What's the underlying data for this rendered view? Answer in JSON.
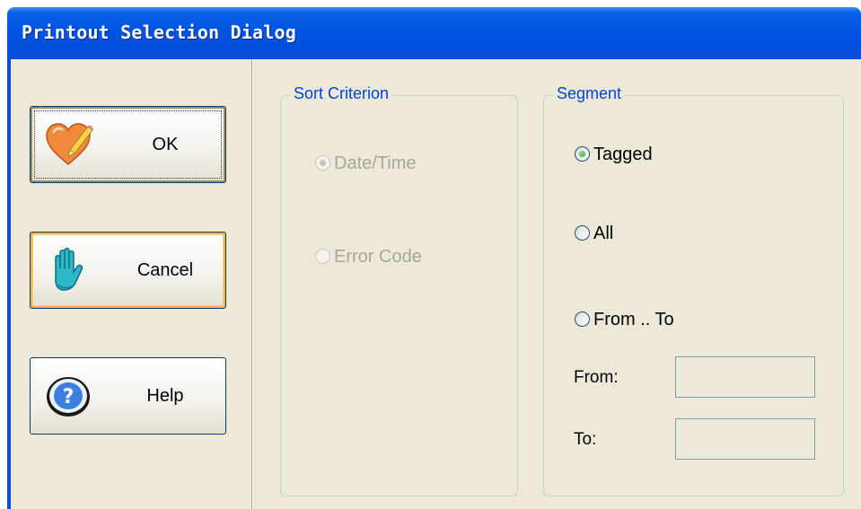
{
  "window": {
    "title": "Printout Selection Dialog"
  },
  "buttons": {
    "ok": {
      "label": "OK",
      "icon": "heart-pencil-icon"
    },
    "cancel": {
      "label": "Cancel",
      "icon": "hand-stop-icon"
    },
    "help": {
      "label": "Help",
      "icon": "question-mark-icon"
    }
  },
  "sort_criterion": {
    "label": "Sort Criterion",
    "enabled": false,
    "options": [
      {
        "label": "Date/Time",
        "checked": true
      },
      {
        "label": "Error Code",
        "checked": false
      }
    ]
  },
  "segment": {
    "label": "Segment",
    "options": [
      {
        "label": "Tagged",
        "checked": true
      },
      {
        "label": "All",
        "checked": false
      },
      {
        "label": "From .. To",
        "checked": false
      }
    ],
    "from": {
      "label": "From:",
      "value": ""
    },
    "to": {
      "label": "To:",
      "value": ""
    }
  },
  "colors": {
    "title_bar": "#0054e3",
    "dialog_bg": "#ece9d8",
    "group_label": "#0046d5",
    "radio_checked": "#21a121"
  }
}
